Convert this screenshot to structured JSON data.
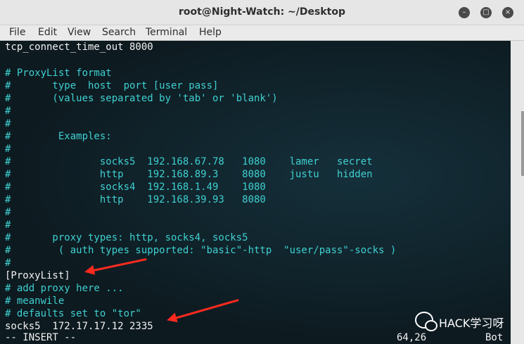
{
  "window": {
    "title": "root@Night-Watch: ~/Desktop",
    "buttons": {
      "minimize": "–",
      "maximize": "□",
      "close": "×"
    }
  },
  "menu": [
    "File",
    "Edit",
    "View",
    "Search",
    "Terminal",
    "Help"
  ],
  "lines": [
    "tcp_connect_time_out 8000",
    "",
    "# ProxyList format",
    "#       type  host  port [user pass]",
    "#       (values separated by 'tab' or 'blank')",
    "#",
    "#",
    "#        Examples:",
    "#",
    "#               socks5  192.168.67.78   1080    lamer   secret",
    "#               http    192.168.89.3    8080    justu   hidden",
    "#               socks4  192.168.1.49    1080",
    "#               http    192.168.39.93   8080",
    "#",
    "#",
    "#       proxy types: http, socks4, socks5",
    "#        ( auth types supported: \"basic\"-http  \"user/pass\"-socks )",
    "#",
    "[ProxyList]",
    "# add proxy here ...",
    "# meanwile",
    "# defaults set to \"tor\"",
    "socks5  172.17.17.12 2335"
  ],
  "status": {
    "mode": "-- INSERT --",
    "position": "64,26",
    "scroll": "Bot"
  },
  "watermark": "HACK学习呀",
  "colors": {
    "comment": "#3fd0d0",
    "text": "#f2f2f2",
    "background": "#0d1a20",
    "arrow": "#ff2a1f"
  }
}
